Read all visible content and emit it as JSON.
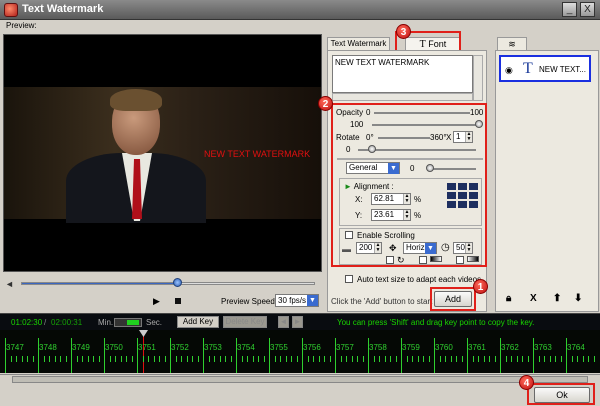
{
  "window": {
    "title": "Text Watermark",
    "minimize": "_",
    "close": "X"
  },
  "menu": {
    "preview_label": "Preview:"
  },
  "video": {
    "watermark_text": "NEW TEXT WATERMARK"
  },
  "player": {
    "play_icon": "play-icon",
    "stop_icon": "stop-icon",
    "seek_progress": 0.52,
    "speed_label": "Preview Speed:",
    "speed_value": "30 fps/s"
  },
  "tabs": {
    "text_watermark": "Text Watermark",
    "font": "Font",
    "font_glyph": "T"
  },
  "editor": {
    "text_value": "NEW TEXT WATERMARK"
  },
  "opacity": {
    "label": "Opacity",
    "min": "0",
    "max": "100",
    "value": "100"
  },
  "rotate": {
    "label": "Rotate",
    "min": "0°",
    "max": "360°",
    "times": "X",
    "multiplier": "1",
    "value": "0"
  },
  "preset": {
    "value": "General",
    "amount": "0"
  },
  "alignment": {
    "label": "Alignment :",
    "x_label": "X:",
    "x_value": "62.81",
    "y_label": "Y:",
    "y_value": "23.61",
    "unit": "%"
  },
  "scrolling": {
    "label": "Enable Scrolling",
    "speed": "200",
    "direction": "Horiz",
    "duration": "50"
  },
  "auto_text": {
    "label": "Auto text size to adapt each videos"
  },
  "add": {
    "hint": "Click the 'Add' button to start >",
    "label": "Add"
  },
  "list": {
    "tab_icon": "layers-icon",
    "item_name": "NEW TEXT...",
    "item_glyph": "T"
  },
  "list_buttons": {
    "delete": "X"
  },
  "timeline": {
    "current": "01:02:30",
    "separator": "/",
    "total": "02:00:31",
    "min_label": "Min.",
    "sec_label": "Sec.",
    "add_key": "Add Key",
    "delete_key": "Delete Key",
    "hint": "You can press 'Shift' and drag key point to copy the key.",
    "ticks": [
      "3747",
      "3748",
      "3749",
      "3750",
      "3751",
      "3752",
      "3753",
      "3754",
      "3755",
      "3756",
      "3757",
      "3758",
      "3759",
      "3760",
      "3761",
      "3762",
      "3763",
      "3764"
    ]
  },
  "ok": {
    "label": "Ok"
  },
  "badges": {
    "b1": "1",
    "b2": "2",
    "b3": "3",
    "b4": "4"
  },
  "colors": {
    "accent_red": "#e0201a",
    "timeline_green": "#19d400",
    "selection_blue": "#1a2fe0"
  }
}
